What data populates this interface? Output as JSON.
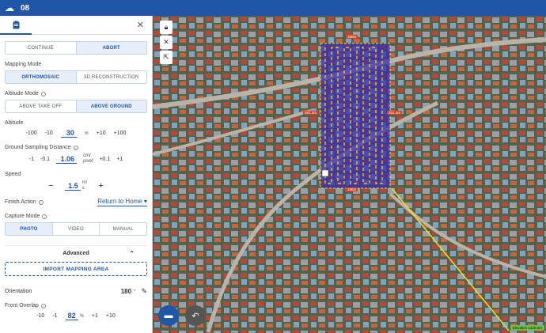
{
  "topbar": {
    "menu_icon": "cloud-icon",
    "title": "08"
  },
  "panel": {
    "tab_icon": "clipboard-icon",
    "actions": [
      "CONTINUE",
      "ABORT"
    ],
    "mapping_mode": {
      "label": "Mapping Mode",
      "options": [
        "ORTHOMOSAIC",
        "3D RECONSTRUCTION"
      ],
      "selected": 0
    },
    "altitude_mode": {
      "label": "Altitude Mode",
      "options": [
        "ABOVE TAKE OFF",
        "ABOVE GROUND"
      ],
      "selected": 1
    },
    "altitude": {
      "label": "Altitude",
      "steps_down": [
        "-100",
        "-10"
      ],
      "value": "30",
      "unit": "m",
      "steps_up": [
        "+10",
        "+100"
      ]
    },
    "gsd": {
      "label": "Ground Sampling Distance",
      "steps_down": [
        "-1",
        "-0.1"
      ],
      "value": "1.06",
      "unit": "cm/\npixel",
      "steps_up": [
        "+0.1",
        "+1"
      ]
    },
    "speed": {
      "label": "Speed",
      "minus": "−",
      "value": "1.5",
      "unit": "m/\ns",
      "plus": "+"
    },
    "finish_action": {
      "label": "Finish Action",
      "value": "Return to Home"
    },
    "capture_mode": {
      "label": "Capture Mode",
      "options": [
        "PHOTO",
        "VIDEO",
        "MANUAL"
      ],
      "selected": 0
    },
    "advanced": {
      "label": "Advanced"
    },
    "import_button": "IMPORT MAPPING AREA",
    "orientation": {
      "label": "Orientation",
      "value": "180",
      "unit": "°"
    },
    "front_overlap": {
      "label": "Front Overlap",
      "steps_down": [
        "-10",
        "-1"
      ],
      "value": "82",
      "unit": "%",
      "steps_up": [
        "+1",
        "+10"
      ]
    }
  },
  "map": {
    "labels": {
      "top": "180m",
      "left": "201.3m",
      "right": "201.3m",
      "bottom": "180m"
    },
    "elevation": "Elevation 1425.0m",
    "colors": {
      "flight_area": "#3a2bb0",
      "path": "#f2e024",
      "line": "#f2e024"
    }
  }
}
